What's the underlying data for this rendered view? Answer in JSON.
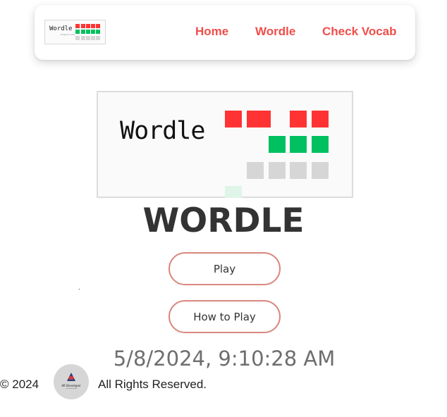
{
  "nav": {
    "logo": {
      "word": "Wordle",
      "subtitle": "Pingrid Lucas"
    },
    "links": [
      {
        "label": "Home"
      },
      {
        "label": "Wordle"
      },
      {
        "label": "Check Vocab"
      }
    ]
  },
  "hero": {
    "logo_word": "Wordle",
    "title": "WORDLE"
  },
  "buttons": {
    "play": "Play",
    "how_to_play": "How to Play"
  },
  "datetime": "5/8/2024, 9:10:28 AM",
  "footer": {
    "copyright": "© 2024",
    "avatar_text": "AR Developer",
    "avatar_subtext": "a tutorial by AR",
    "rights": "All Rights Reserved."
  },
  "colors": {
    "red_tile": "#ff3333",
    "green_tile": "#00c060",
    "gray_tile": "#d6d6d6",
    "nav_link": "#f04e4a",
    "button_border": "#d9877d"
  }
}
